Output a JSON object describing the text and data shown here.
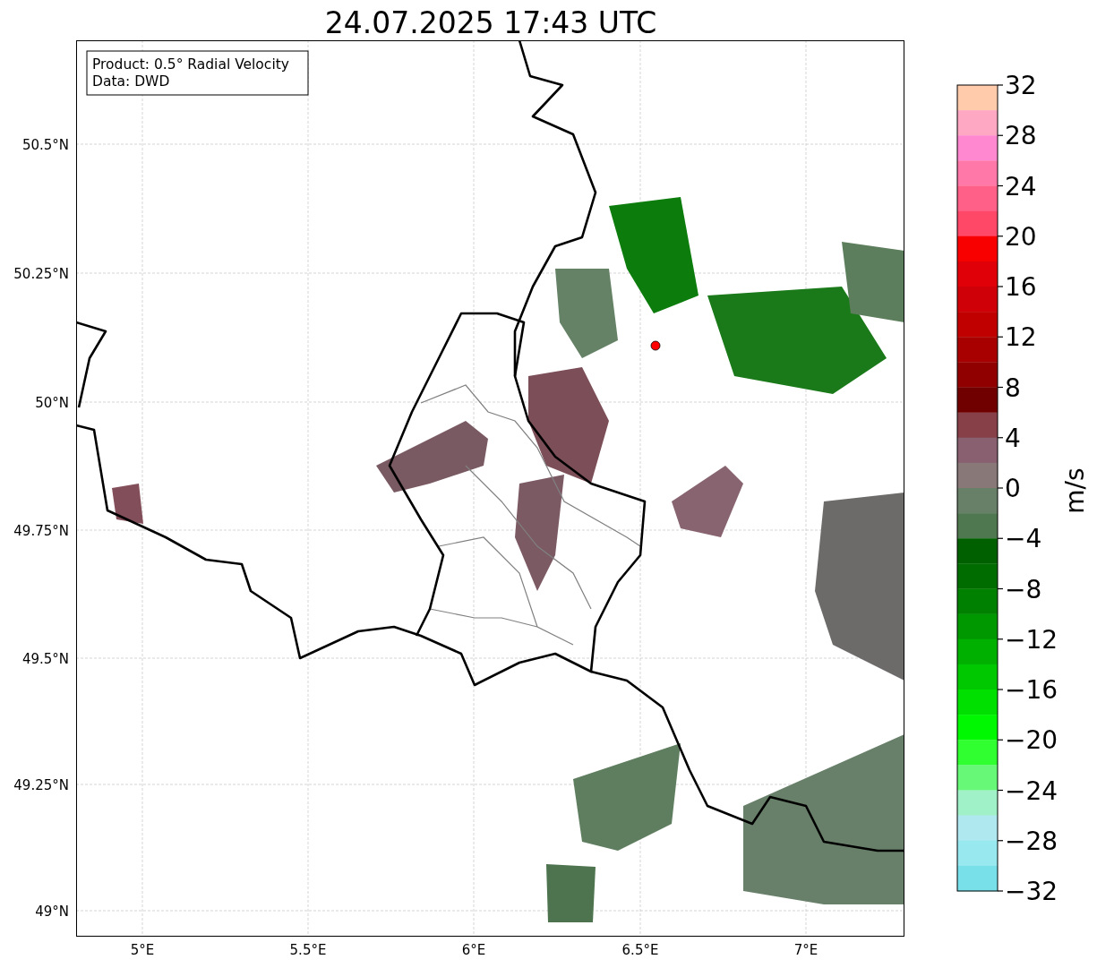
{
  "title": "24.07.2025 17:43 UTC",
  "info_box": [
    "Product: 0.5° Radial Velocity",
    "Data: DWD"
  ],
  "lat_ticks": [
    "50.5°N",
    "50.25°N",
    "50°N",
    "49.75°N",
    "49.5°N",
    "49.25°N",
    "49°N"
  ],
  "lon_ticks": [
    "5°E",
    "5.5°E",
    "6°E",
    "6.5°E",
    "7°E"
  ],
  "colorbar": {
    "label": "m/s",
    "ticks": [
      "32",
      "28",
      "24",
      "20",
      "16",
      "12",
      "8",
      "4",
      "0",
      "−4",
      "−8",
      "−12",
      "−16",
      "−20",
      "−24",
      "−28",
      "−32"
    ],
    "bands": [
      {
        "color": "#ffcbab"
      },
      {
        "color": "#ffa8c4"
      },
      {
        "color": "#ff88d0"
      },
      {
        "color": "#ff78a8"
      },
      {
        "color": "#ff6088"
      },
      {
        "color": "#ff4868"
      },
      {
        "color": "#f80000"
      },
      {
        "color": "#e00008"
      },
      {
        "color": "#d00008"
      },
      {
        "color": "#c00000"
      },
      {
        "color": "#a80000"
      },
      {
        "color": "#900000"
      },
      {
        "color": "#700000"
      },
      {
        "color": "#884048"
      },
      {
        "color": "#886070"
      },
      {
        "color": "#887878"
      },
      {
        "color": "#688068"
      },
      {
        "color": "#507850"
      },
      {
        "color": "#006000"
      },
      {
        "color": "#006c00"
      },
      {
        "color": "#008000"
      },
      {
        "color": "#009800"
      },
      {
        "color": "#00b000"
      },
      {
        "color": "#00c800"
      },
      {
        "color": "#00e000"
      },
      {
        "color": "#00f800"
      },
      {
        "color": "#30ff30"
      },
      {
        "color": "#68f878"
      },
      {
        "color": "#a0f0c8"
      },
      {
        "color": "#b0e8f0"
      },
      {
        "color": "#98e8f0"
      },
      {
        "color": "#78e0e8"
      }
    ]
  }
}
